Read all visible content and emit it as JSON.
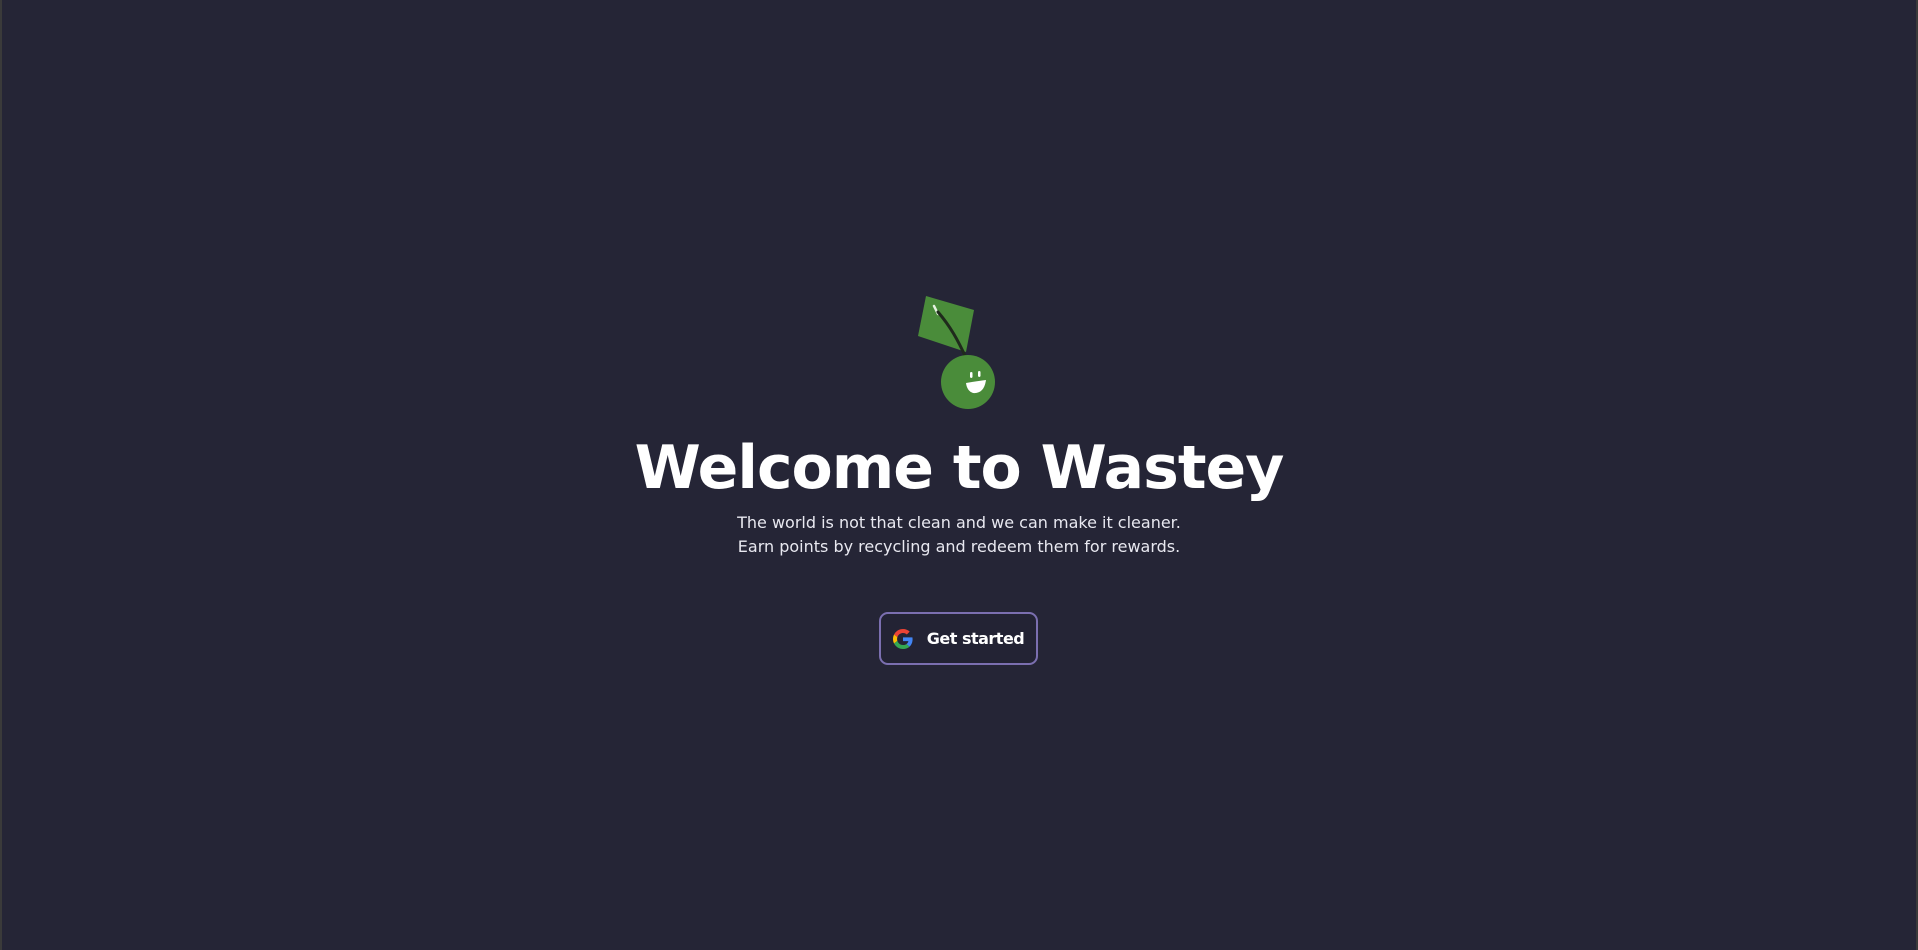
{
  "app": {
    "background_color": "#252536",
    "accent_color": "#7b6fb0",
    "mascot_color": "#4a8c3a"
  },
  "hero": {
    "logo_icon": "leaf-mascot-icon",
    "title": "Welcome to Wastey",
    "subtitle_line1": "The world is not that clean and we can make it cleaner.",
    "subtitle_line2": "Earn points by recycling and redeem them for rewards."
  },
  "cta": {
    "icon": "google-icon",
    "label": "Get started"
  }
}
